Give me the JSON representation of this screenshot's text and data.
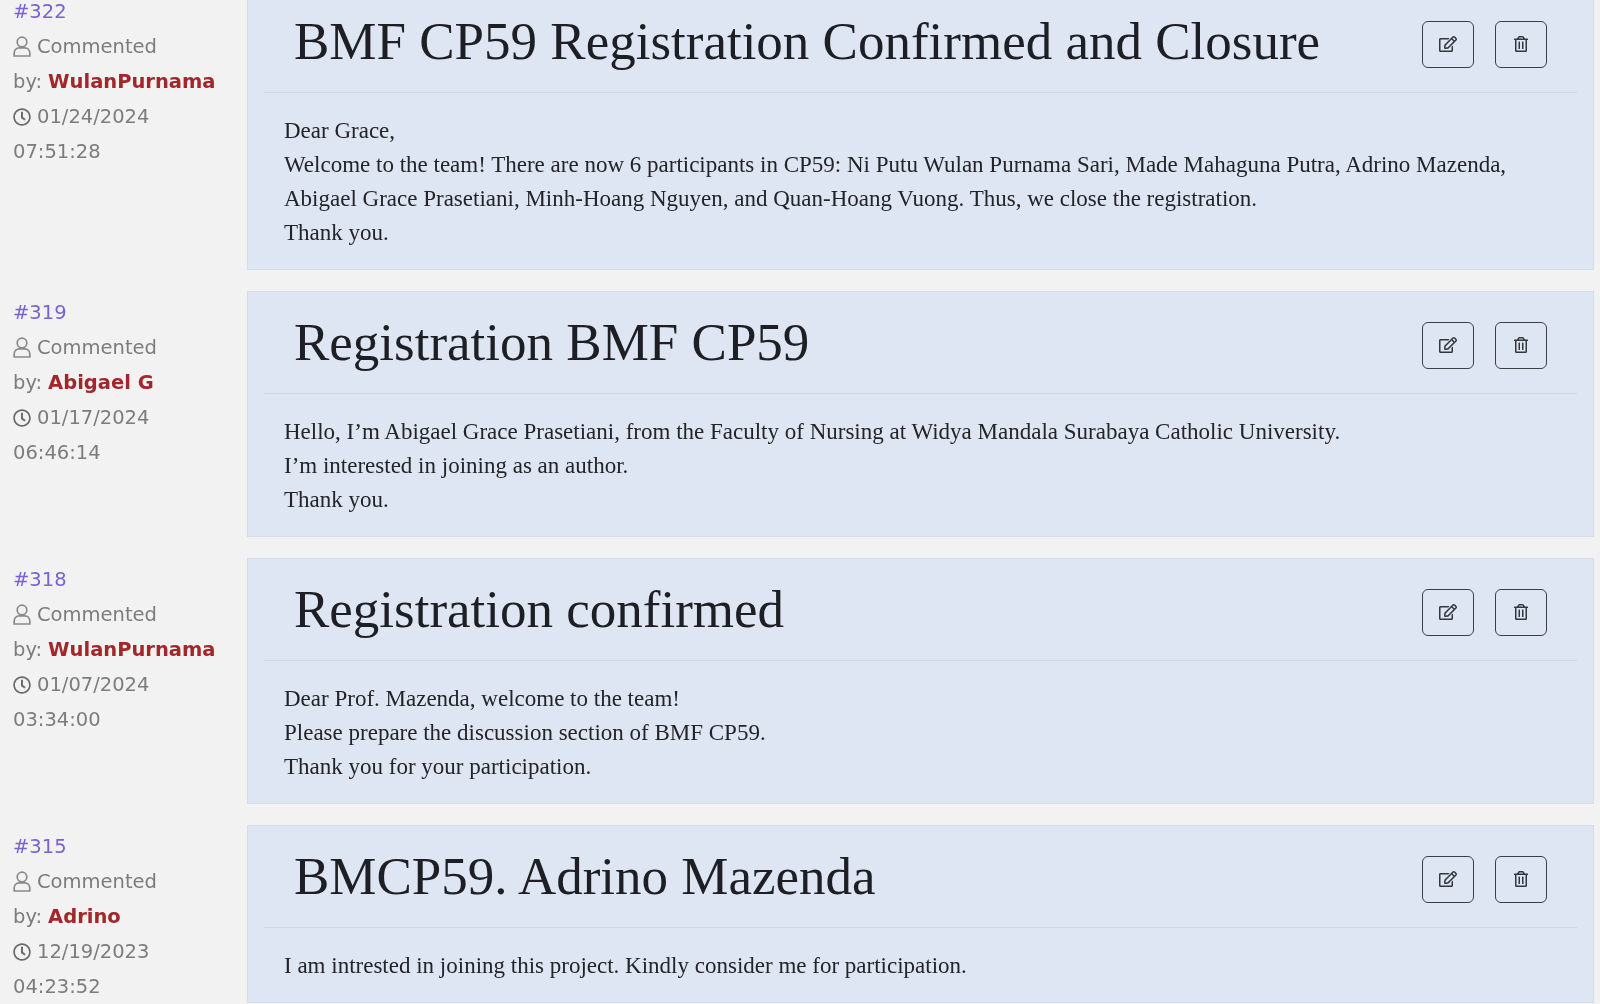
{
  "comments": [
    {
      "number": "#322",
      "action": "Commented",
      "by_label": "by:",
      "author": "WulanPurnama",
      "date": "01/24/2024",
      "time": "07:51:28",
      "title": "BMF CP59 Registration Confirmed and Closure",
      "body": [
        "Dear Grace,",
        "Welcome to the team! There are now 6 participants in CP59: Ni Putu Wulan Purnama Sari, Made Mahaguna Putra, Adrino Mazenda, Abigael Grace Prasetiani, Minh-Hoang Nguyen, and Quan-Hoang Vuong. Thus, we close the registration.",
        "Thank you."
      ]
    },
    {
      "number": "#319",
      "action": "Commented",
      "by_label": "by:",
      "author": "Abigael G",
      "date": "01/17/2024",
      "time": "06:46:14",
      "title": "Registration BMF CP59",
      "body": [
        "Hello, I’m Abigael Grace Prasetiani, from the Faculty of Nursing at Widya Mandala Surabaya Catholic University.",
        "I’m interested in joining as an author.",
        "Thank you."
      ]
    },
    {
      "number": "#318",
      "action": "Commented",
      "by_label": "by:",
      "author": "WulanPurnama",
      "date": "01/07/2024",
      "time": "03:34:00",
      "title": "Registration confirmed",
      "body": [
        "Dear Prof. Mazenda, welcome to the team!",
        "Please prepare the discussion section of BMF CP59.",
        "Thank you for your participation."
      ]
    },
    {
      "number": "#315",
      "action": "Commented",
      "by_label": "by:",
      "author": "Adrino",
      "date": "12/19/2023",
      "time": "04:23:52",
      "title": "BMCP59. Adrino Mazenda",
      "body": [
        "I am intrested in joining this project. Kindly consider me for participation."
      ]
    }
  ]
}
